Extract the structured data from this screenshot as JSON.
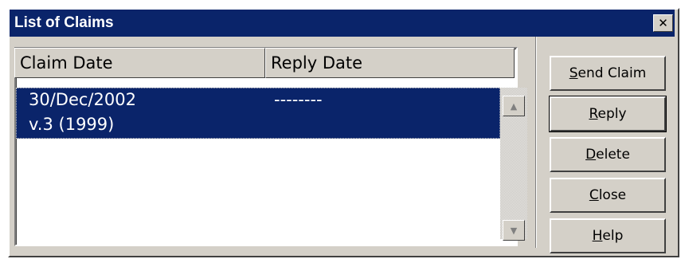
{
  "window": {
    "title": "List of Claims",
    "close_glyph": "✕"
  },
  "list": {
    "columns": [
      {
        "label": "Claim Date"
      },
      {
        "label": "Reply Date"
      }
    ],
    "rows": [
      {
        "claim_date": "30/Dec/2002",
        "reply_date": "--------",
        "subtitle": "v.3 (1999)"
      }
    ],
    "scroll_up_glyph": "▲",
    "scroll_down_glyph": "▼"
  },
  "buttons": {
    "send_claim": {
      "mnemonic": "S",
      "rest": "end Claim"
    },
    "reply": {
      "mnemonic": "R",
      "rest": "eply"
    },
    "delete": {
      "mnemonic": "D",
      "rest": "elete"
    },
    "close": {
      "mnemonic": "C",
      "rest": "lose"
    },
    "help": {
      "mnemonic": "H",
      "rest": "elp"
    }
  },
  "colors": {
    "titlebar": "#0a246a",
    "selection": "#0a246a",
    "face": "#d4d0c8"
  }
}
